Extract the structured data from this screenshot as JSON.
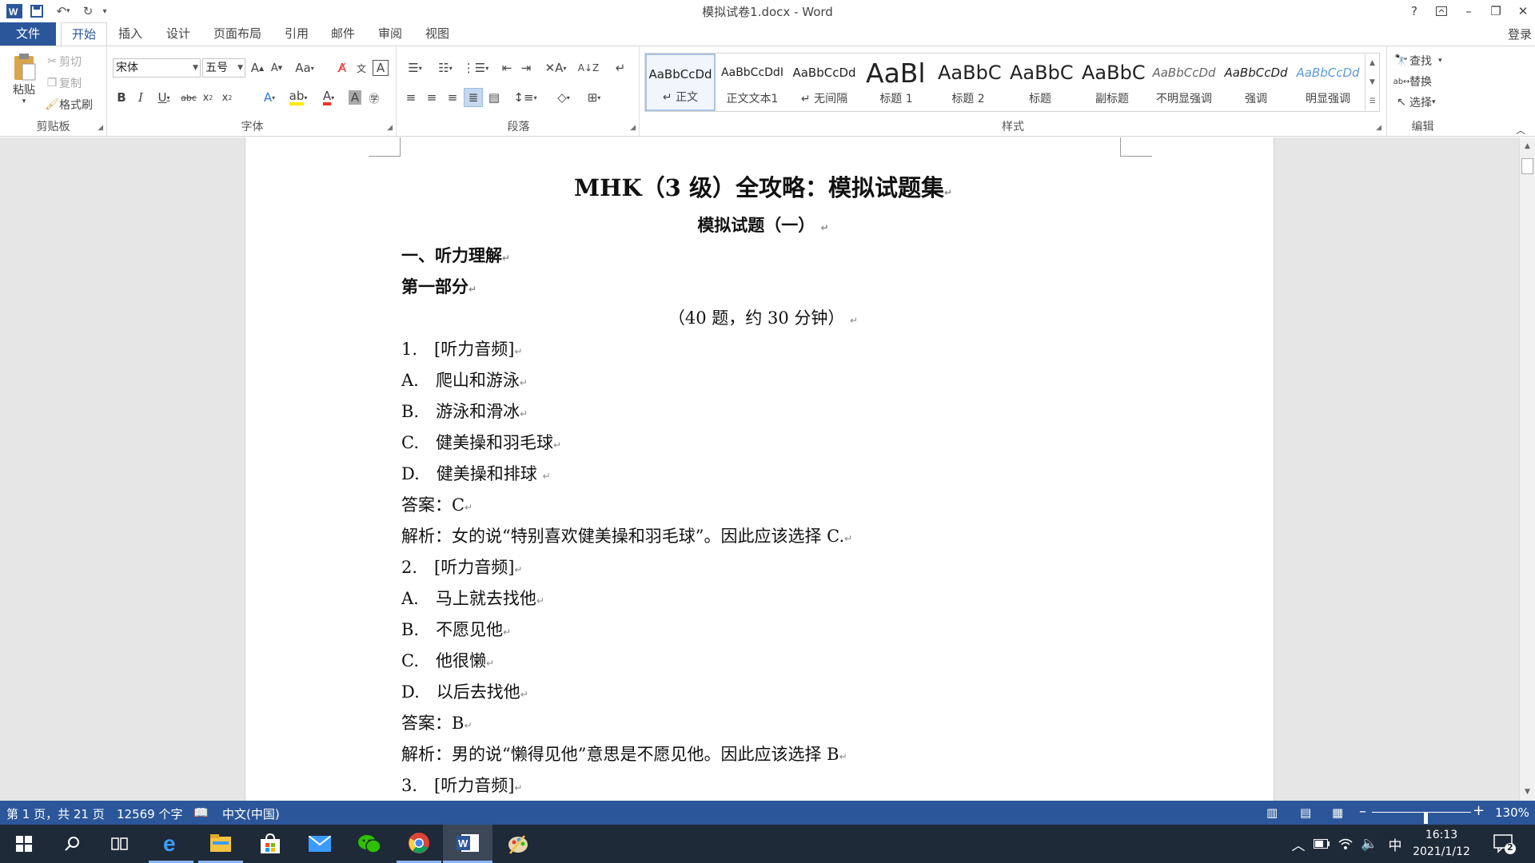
{
  "window": {
    "title": "模拟试卷1.docx - Word",
    "help": "?",
    "login": "登录"
  },
  "tabs": [
    {
      "label": "文件"
    },
    {
      "label": "开始"
    },
    {
      "label": "插入"
    },
    {
      "label": "设计"
    },
    {
      "label": "页面布局"
    },
    {
      "label": "引用"
    },
    {
      "label": "邮件"
    },
    {
      "label": "审阅"
    },
    {
      "label": "视图"
    }
  ],
  "clipboard": {
    "paste": "粘贴",
    "cut": "剪切",
    "copy": "复制",
    "format_painter": "格式刷",
    "label": "剪贴板"
  },
  "font": {
    "name": "宋体",
    "size": "五号",
    "label": "字体",
    "case": "Aa"
  },
  "paragraph": {
    "label": "段落"
  },
  "styles": {
    "label": "样式",
    "items": [
      {
        "preview": "AaBbCcDd",
        "name": "↵ 正文"
      },
      {
        "preview": "AaBbCcDdI",
        "name": "正文文本1"
      },
      {
        "preview": "AaBbCcDd",
        "name": "↵ 无间隔"
      },
      {
        "preview": "AaBl",
        "name": "标题 1"
      },
      {
        "preview": "AaBbC",
        "name": "标题 2"
      },
      {
        "preview": "AaBbC",
        "name": "标题"
      },
      {
        "preview": "AaBbC",
        "name": "副标题"
      },
      {
        "preview": "AaBbCcDd",
        "name": "不明显强调"
      },
      {
        "preview": "AaBbCcDd",
        "name": "强调"
      },
      {
        "preview": "AaBbCcDd",
        "name": "明显强调"
      }
    ]
  },
  "editing": {
    "find": "查找",
    "replace": "替换",
    "select": "选择",
    "label": "编辑"
  },
  "document": {
    "title": "MHK（3 级）全攻略：模拟试题集",
    "subtitle": "模拟试题（一）",
    "section": "一、听力理解",
    "part": "第一部分",
    "instructions": "（40 题，约 30 分钟）",
    "lines": [
      "1.　[听力音频]",
      "A.　爬山和游泳",
      "B.　游泳和滑冰",
      "C.　健美操和羽毛球",
      "D.　健美操和排球",
      "答案：C",
      "解析：女的说“特别喜欢健美操和羽毛球”。因此应该选择 C.",
      "2.　[听力音频]",
      "A.　马上就去找他",
      "B.　不愿见他",
      "C.　他很懒",
      "D.　以后去找他",
      "答案：B",
      "解析：男的说“懒得见他”意思是不愿见他。因此应该选择 B",
      "3.　[听力音频]"
    ]
  },
  "status": {
    "page": "第 1 页，共 21 页",
    "words": "12569 个字",
    "language": "中文(中国)",
    "zoom": "130%",
    "zoom_level": 1.3
  },
  "taskbar": {
    "time": "16:13",
    "date": "2021/1/12",
    "ime": "中",
    "notifications": "2"
  },
  "colors": {
    "accent": "#2b579a",
    "taskbar": "#1f2a38"
  }
}
